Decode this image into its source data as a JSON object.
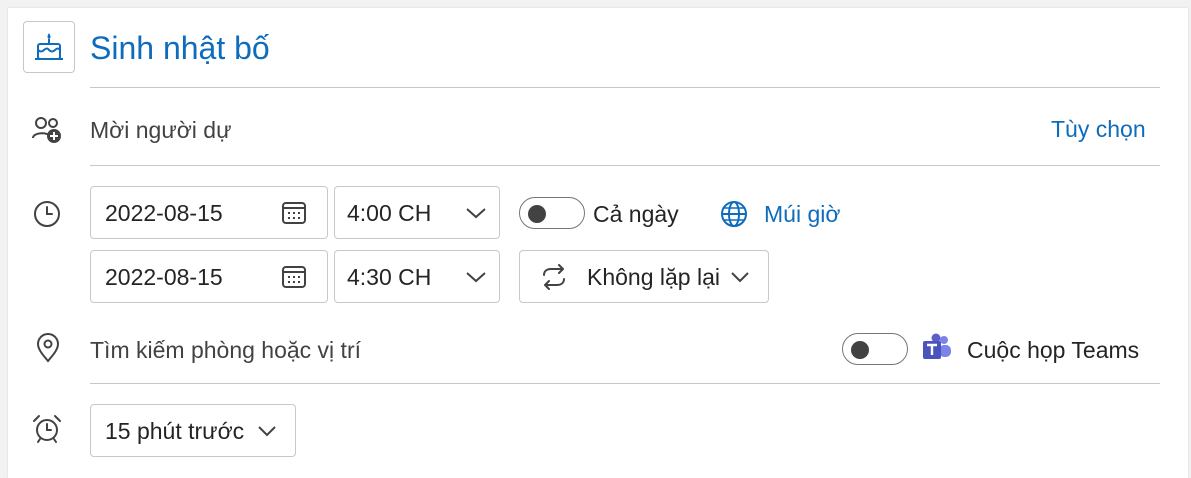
{
  "event": {
    "title": "Sinh nhật bố"
  },
  "attendees": {
    "placeholder": "Mời người dự",
    "options_link": "Tùy chọn"
  },
  "schedule": {
    "start_date": "2022-08-15",
    "start_time": "4:00 CH",
    "end_date": "2022-08-15",
    "end_time": "4:30 CH",
    "all_day_label": "Cả ngày",
    "all_day_on": false,
    "timezone_link": "Múi giờ",
    "repeat_value": "Không lặp lại"
  },
  "location": {
    "placeholder": "Tìm kiếm phòng hoặc vị trí",
    "teams_label": "Cuộc họp Teams",
    "teams_on": false
  },
  "reminder": {
    "value": "15 phút trước"
  },
  "colors": {
    "accent": "#0f6cbd",
    "teams": "#5b5fc7",
    "border": "#c8c8c8"
  }
}
